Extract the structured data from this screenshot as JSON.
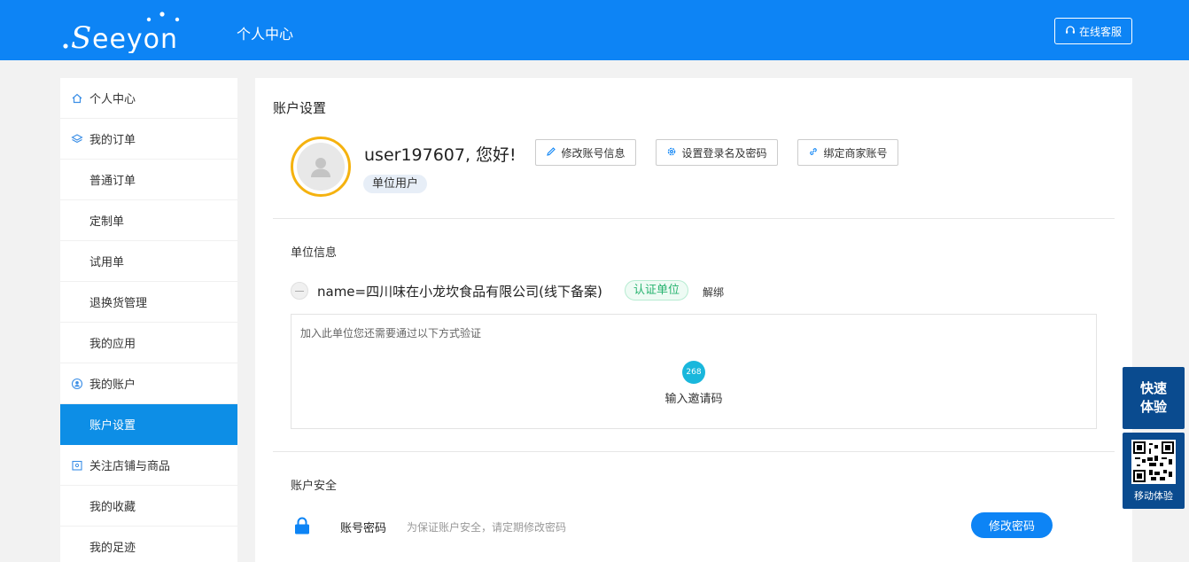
{
  "header": {
    "logo_text": "Seeyon",
    "title": "个人中心",
    "service_button": "在线客服"
  },
  "sidebar": {
    "items": [
      {
        "label": "个人中心",
        "icon": "home-icon"
      },
      {
        "label": "我的订单",
        "icon": "layers-icon"
      },
      {
        "label": "普通订单"
      },
      {
        "label": "定制单"
      },
      {
        "label": "试用单"
      },
      {
        "label": "退换货管理"
      },
      {
        "label": "我的应用"
      },
      {
        "label": "我的账户",
        "icon": "user-circle-icon"
      },
      {
        "label": "账户设置",
        "active": true
      },
      {
        "label": "关注店铺与商品",
        "icon": "store-icon"
      },
      {
        "label": "我的收藏"
      },
      {
        "label": "我的足迹"
      }
    ]
  },
  "main": {
    "page_title": "账户设置",
    "greeting": "user197607, 您好!",
    "role_badge": "单位用户",
    "actions": {
      "edit_info": "修改账号信息",
      "set_login": "设置登录名及密码",
      "bind_merchant": "绑定商家账号"
    },
    "unit_section": {
      "title": "单位信息",
      "unit_name": "name=四川味在小龙坎食品有限公司(线下备案)",
      "cert_badge": "认证单位",
      "unbind": "解绑",
      "verify_hint": "加入此单位您还需要通过以下方式验证",
      "invite_icon_text": "268",
      "invite_label": "输入邀请码"
    },
    "security_section": {
      "title": "账户安全",
      "password_label": "账号密码",
      "password_hint": "为保证账户安全，请定期修改密码",
      "change_button": "修改密码"
    }
  },
  "float": {
    "quick_line1": "快速",
    "quick_line2": "体验",
    "mobile_label": "移动体验"
  },
  "colors": {
    "header_bg": "#0d84f5",
    "active_menu": "#0d8ee6",
    "avatar_ring": "#f5b20f",
    "cert_green": "#27b36f",
    "float_bg": "#0a4b8f"
  }
}
